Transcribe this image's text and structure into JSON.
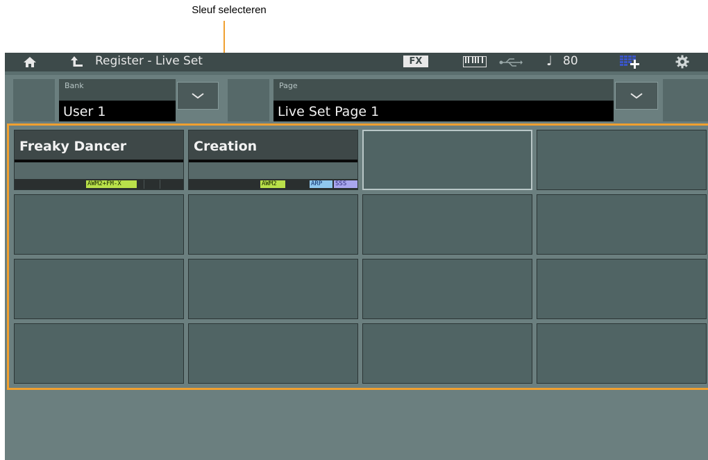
{
  "callout": {
    "label": "Sleuf selecteren"
  },
  "titlebar": {
    "title": "Register - Live Set",
    "fx_label": "FX",
    "tempo": "80",
    "icons": [
      "home-icon",
      "up-arrow-icon",
      "keyboard-icon",
      "usb-icon",
      "note-icon",
      "quick-setup-icon",
      "gear-icon"
    ]
  },
  "bank": {
    "label": "Bank",
    "value": "User 1"
  },
  "page": {
    "label": "Page",
    "value": "Live Set Page  1"
  },
  "slots": [
    {
      "name": "Freaky Dancer",
      "badges": [
        "AWM2+FM-X"
      ]
    },
    {
      "name": "Creation",
      "badges": [
        "AWM2",
        "ARP",
        "SSS"
      ]
    },
    {
      "name": ""
    },
    {
      "name": ""
    },
    {
      "name": ""
    },
    {
      "name": ""
    },
    {
      "name": ""
    },
    {
      "name": ""
    },
    {
      "name": ""
    },
    {
      "name": ""
    },
    {
      "name": ""
    },
    {
      "name": ""
    },
    {
      "name": ""
    },
    {
      "name": ""
    },
    {
      "name": ""
    },
    {
      "name": ""
    }
  ],
  "colors": {
    "highlight": "#f0a030",
    "screen_bg": "#6b7f7f",
    "titlebar_bg": "#3d4a4a",
    "awm_badge": "#b9e04a",
    "fmx_badge": "#59d8a8",
    "arp_badge": "#8fc7ee",
    "sss_badge": "#a9a6ee"
  }
}
